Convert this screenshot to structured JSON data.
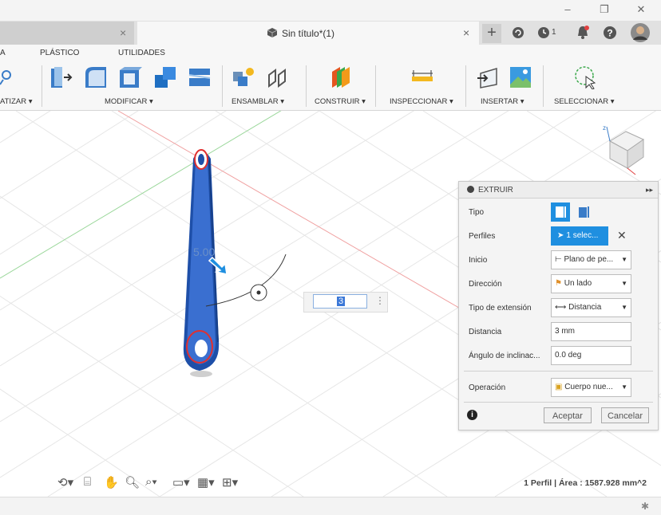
{
  "window": {
    "minimize": "–",
    "restore": "❐",
    "close": "✕"
  },
  "tabs": {
    "left_close": "×",
    "active_title": "Sin título*(1)",
    "active_close": "×",
    "add": "+",
    "clock_count": "1"
  },
  "ribbon": {
    "tabs": [
      "A",
      "PLÁSTICO",
      "UTILIDADES"
    ],
    "groups": {
      "visualizar": "ATIZAR ▾",
      "modificar": "MODIFICAR ▾",
      "ensamblar": "ENSAMBLAR ▾",
      "construir": "CONSTRUIR ▾",
      "inspeccionar": "INSPECCIONAR ▾",
      "insertar": "INSERTAR ▾",
      "seleccionar": "SELECCIONAR ▾"
    }
  },
  "viewport": {
    "manipulator_value": "3",
    "dim_text": "5.00"
  },
  "panel": {
    "title": "EXTRUIR",
    "collapse": "▸▸",
    "rows": {
      "tipo": "Tipo",
      "perfiles": "Perfiles",
      "perfiles_value": "1 selec...",
      "inicio": "Inicio",
      "inicio_value": "Plano de pe...",
      "direccion": "Dirección",
      "direccion_value": "Un lado",
      "tipo_ext": "Tipo de extensión",
      "tipo_ext_value": "Distancia",
      "distancia": "Distancia",
      "distancia_value": "3 mm",
      "angulo": "Ángulo de inclinac...",
      "angulo_value": "0.0 deg",
      "operacion": "Operación",
      "operacion_value": "Cuerpo nue..."
    },
    "ok": "Aceptar",
    "cancel": "Cancelar",
    "info": "i"
  },
  "status": {
    "profile_info": "1 Perfil | Área : 1587.928 mm^2"
  },
  "colors": {
    "selection_blue": "#1f8fe0",
    "body_blue": "#2a5cb8"
  }
}
